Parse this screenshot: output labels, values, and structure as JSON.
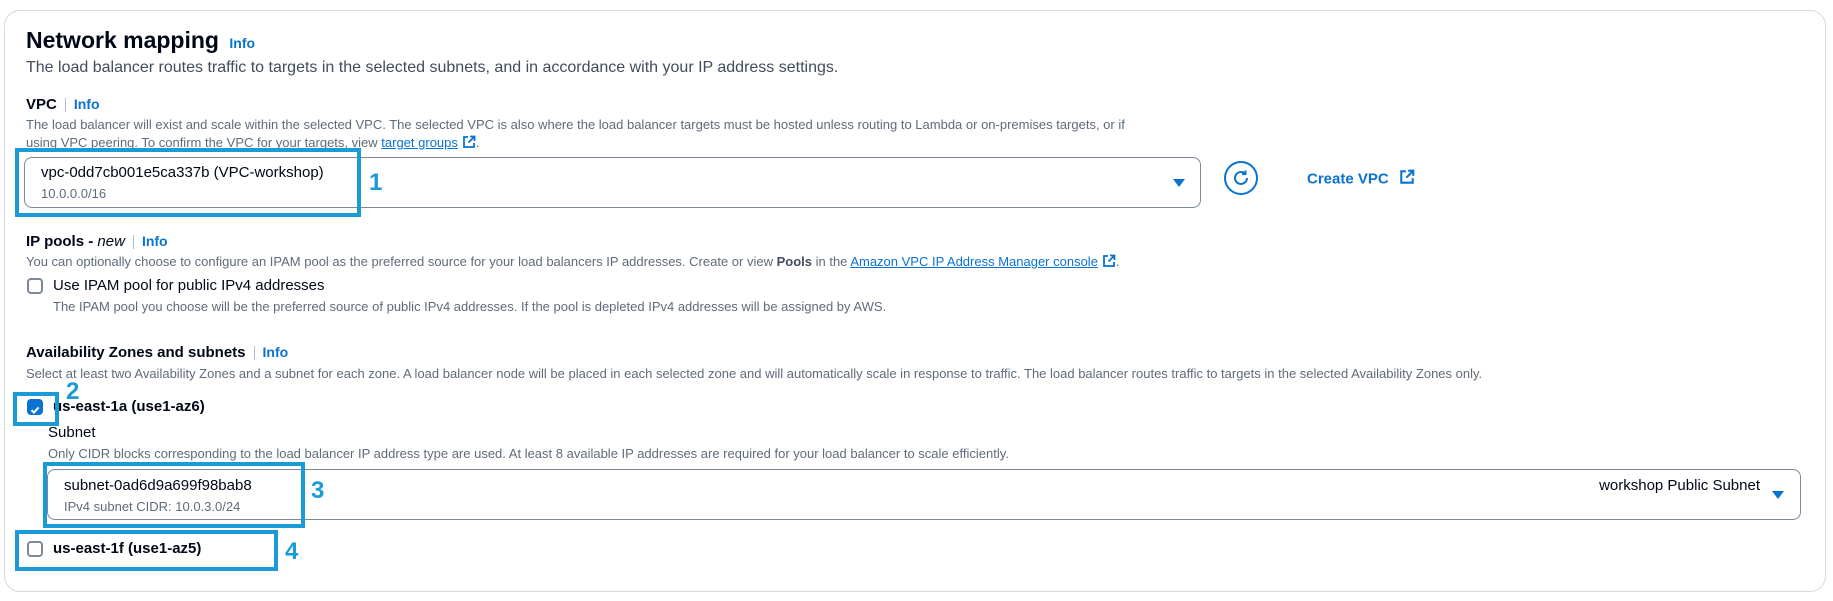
{
  "section": {
    "title": "Network mapping",
    "info": "Info",
    "description": "The load balancer routes traffic to targets in the selected subnets, and in accordance with your IP address settings."
  },
  "vpc": {
    "label": "VPC",
    "info": "Info",
    "desc_line1": "The load balancer will exist and scale within the selected VPC. The selected VPC is also where the load balancer targets must be hosted unless routing to Lambda or on-premises targets, or if",
    "desc_line2": "using VPC peering. To confirm the VPC for your targets, view",
    "desc_link": "target groups",
    "desc_end": ".",
    "selected_value": "vpc-0dd7cb001e5ca337b (VPC-workshop)",
    "selected_cidr": "10.0.0.0/16",
    "create_label": "Create VPC"
  },
  "ip_pools": {
    "label": "IP pools - ",
    "label_new": "new",
    "info": "Info",
    "desc_start": "You can optionally choose to configure an IPAM pool as the preferred source for your load balancers IP addresses. Create or view ",
    "desc_bold": "Pools",
    "desc_mid": " in the ",
    "desc_link": "Amazon VPC IP Address Manager console",
    "desc_end": ".",
    "checkbox_label": "Use IPAM pool for public IPv4 addresses",
    "checkbox_desc": "The IPAM pool you choose will be the preferred source of public IPv4 addresses. If the pool is depleted IPv4 addresses will be assigned by AWS.",
    "checked": false
  },
  "az": {
    "label": "Availability Zones and subnets",
    "info": "Info",
    "description": "Select at least two Availability Zones and a subnet for each zone. A load balancer node will be placed in each selected zone and will automatically scale in response to traffic. The load balancer routes traffic to targets in the selected Availability Zones only.",
    "zones": [
      {
        "label": "us-east-1a (use1-az6)",
        "checked": true,
        "subnet_label": "Subnet",
        "subnet_desc": "Only CIDR blocks corresponding to the load balancer IP address type are used. At least 8 available IP addresses are required for your load balancer to scale efficiently.",
        "subnet_value": "subnet-0ad6d9a699f98bab8",
        "subnet_cidr": "IPv4 subnet CIDR: 10.0.3.0/24",
        "subnet_name": "workshop Public Subnet"
      },
      {
        "label": "us-east-1f (use1-az5)",
        "checked": false
      }
    ]
  },
  "annotations": [
    "1",
    "2",
    "3",
    "4"
  ],
  "colors": {
    "accent": "#0972d3",
    "annotation": "#1a9ad6",
    "border": "#7d8998"
  },
  "icons": [
    "refresh-icon",
    "external-link-icon",
    "caret-down-icon",
    "checkmark-icon"
  ]
}
